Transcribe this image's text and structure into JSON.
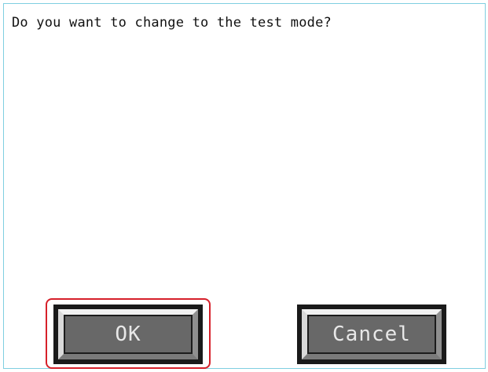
{
  "dialog": {
    "prompt": "Do you want to change to the test mode?"
  },
  "buttons": {
    "ok_label": "OK",
    "cancel_label": "Cancel"
  },
  "colors": {
    "frame_border": "#7fcfe0",
    "highlight": "#d6202a",
    "button_face": "#686868",
    "button_text": "#e8e8e8"
  }
}
